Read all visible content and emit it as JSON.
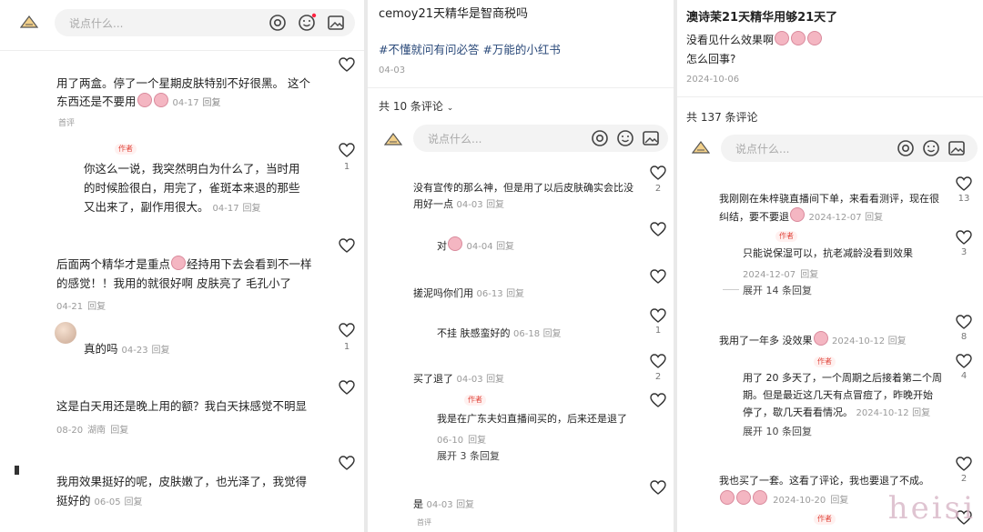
{
  "p1": {
    "search_placeholder": "说点什么...",
    "comments": [
      {
        "text1": "用了两盒。停了一个星期皮肤特别不好很黑。 这个",
        "text2": "东西还是不要用",
        "meta": "04-17",
        "reply": "回复",
        "badge": "首评"
      },
      {
        "author_tag": "作者",
        "text1": "你这么一说，我突然明白为什么了，当时用",
        "text2": "的时候脸很白，用完了，雀斑本来退的那些",
        "text3": "又出来了，副作用很大。",
        "meta": "04-17",
        "reply": "回复",
        "likes": "1"
      },
      {
        "text1": "后面两个精华才是重点",
        "text1b": "经持用下去会看到不一样",
        "text2": "的感觉！！我用的就很好啊 皮肤亮了 毛孔小了",
        "meta": "04-21",
        "reply": "回复"
      },
      {
        "text1": "真的吗",
        "meta": "04-23",
        "reply": "回复",
        "likes": "1"
      },
      {
        "text1": "这是白天用还是晚上用的额？我白天抹感觉不明显",
        "meta": "08-20",
        "loc": "湖南",
        "reply": "回复"
      },
      {
        "text1": "我用效果挺好的呢，皮肤嫩了，也光泽了，我觉得",
        "text2": "挺好的",
        "meta": "06-05",
        "reply": "回复"
      }
    ]
  },
  "p2": {
    "title": "cemoy21天精华是智商税吗",
    "tags": "#不懂就问有问必答 #万能的小红书",
    "date": "04-03",
    "total": "共 10 条评论",
    "search_placeholder": "说点什么...",
    "comments": [
      {
        "text1": "没有宣传的那么神，但是用了以后皮肤确实会比没",
        "text2": "用好一点",
        "meta": "04-03",
        "reply": "回复",
        "likes": "2"
      },
      {
        "text1": "对",
        "meta": "04-04",
        "reply": "回复"
      },
      {
        "text1": "搓泥吗你们用",
        "meta": "06-13",
        "reply": "回复"
      },
      {
        "text1": "不挂 肤感蛮好的",
        "meta": "06-18",
        "reply": "回复",
        "likes": "1"
      },
      {
        "text1": "买了退了",
        "meta": "04-03",
        "reply": "回复",
        "likes": "2"
      },
      {
        "author_tag": "作者",
        "text1": "我是在广东夫妇直播间买的，后来还是退了",
        "meta": "06-10",
        "reply": "回复"
      },
      {
        "expand": "展开 3 条回复"
      },
      {
        "text1": "是",
        "meta": "04-03",
        "reply": "回复"
      },
      {
        "badge": "首评"
      }
    ]
  },
  "p3": {
    "title": "澳诗茉21天精华用够21天了",
    "line1": "没看见什么效果啊",
    "line2": "怎么回事?",
    "date": "2024-10-06",
    "total": "共 137 条评论",
    "search_placeholder": "说点什么...",
    "comments": [
      {
        "text1": "我刚刚在朱梓骁直播间下单，来看看测评，现在很",
        "text2": "纠结，要不要退",
        "meta": "2024-12-07",
        "reply": "回复",
        "likes": "13"
      },
      {
        "author_tag": "作者",
        "text1": "只能说保湿可以，抗老减龄没看到效果",
        "meta": "2024-12-07",
        "reply": "回复",
        "likes": "3"
      },
      {
        "expand": "展开 14 条回复"
      },
      {
        "text1": "我用了一年多 没效果",
        "meta": "2024-10-12",
        "reply": "回复",
        "likes": "8"
      },
      {
        "author_tag": "作者",
        "text1": "用了 20 多天了，一个周期之后接着第二个周",
        "text2": "期。但是最近这几天有点冒痘了，昨晚开始",
        "text3": "停了，歇几天看看情况。",
        "meta": "2024-10-12",
        "reply": "回复",
        "likes": "4"
      },
      {
        "expand": "展开 10 条回复"
      },
      {
        "text1": "我也买了一套。这看了评论，我也要退了不成。",
        "meta": "2024-10-20",
        "reply": "回复",
        "likes": "2"
      },
      {
        "author_tag": "作者"
      }
    ]
  },
  "watermark": "heisi"
}
